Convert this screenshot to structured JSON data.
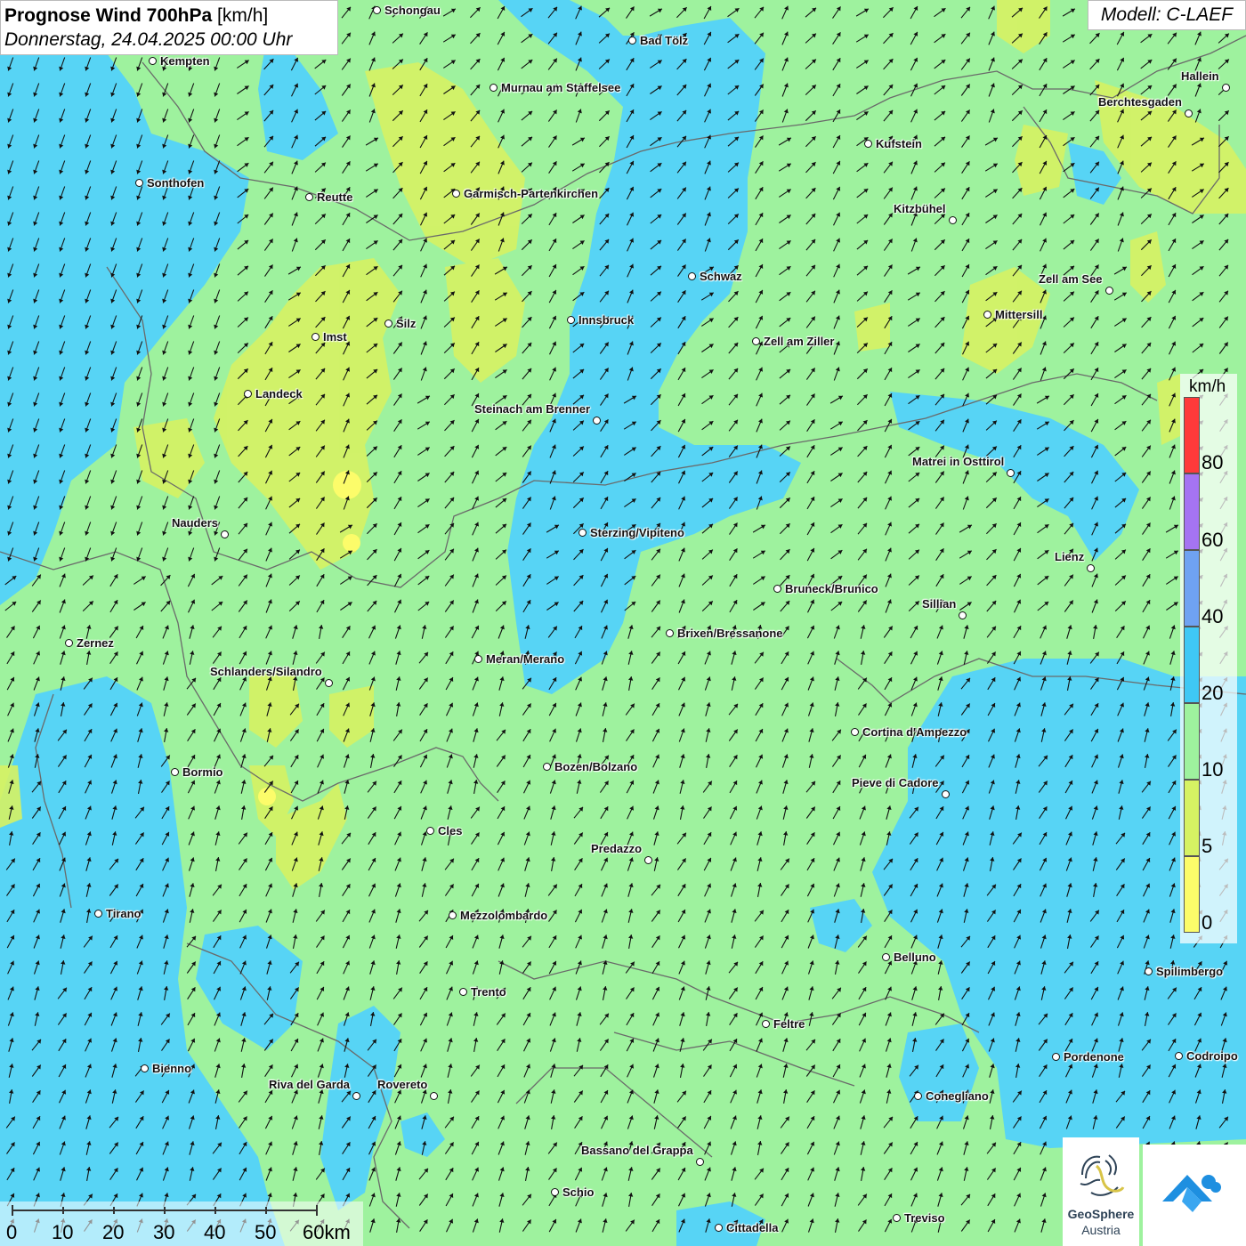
{
  "header": {
    "title_bold": "Prognose Wind 700hPa",
    "title_unit": " [km/h]",
    "date": "Donnerstag, 24.04.2025 00:00 Uhr",
    "model": "Modell: C-LAEF"
  },
  "legend": {
    "unit": "km/h",
    "ticks": [
      "80",
      "60",
      "40",
      "20",
      "10",
      "5",
      "0"
    ],
    "colors": [
      "#ff3a3a",
      "#a574f2",
      "#6fa2f2",
      "#3fc8f5",
      "#9ef29e",
      "#d6f263",
      "#fcfc6a"
    ]
  },
  "scalebar": {
    "labels": [
      "0",
      "10",
      "20",
      "30",
      "40",
      "50",
      "60km"
    ]
  },
  "logo": {
    "name_line1": "GeoSphere",
    "name_line2": "Austria",
    "icon": "geosphere-logo-icon",
    "second_icon": "cloud-arrow-icon"
  },
  "colors": {
    "zone_0_5": "#fcfc6a",
    "zone_5_10": "#d6f263",
    "zone_10_20": "#9ef29e",
    "zone_20_40": "#57d4f5",
    "border": "#6a6a6a"
  },
  "cities": [
    {
      "name": "Schongau"
    },
    {
      "name": "Bad Tölz"
    },
    {
      "name": "Kempten"
    },
    {
      "name": "Murnau am Staffelsee"
    },
    {
      "name": "Hallein"
    },
    {
      "name": "Berchtesgaden"
    },
    {
      "name": "Kufstein"
    },
    {
      "name": "Sonthofen"
    },
    {
      "name": "Reutte"
    },
    {
      "name": "Garmisch-Partenkirchen"
    },
    {
      "name": "Kitzbühel"
    },
    {
      "name": "Schwaz"
    },
    {
      "name": "Zell am See"
    },
    {
      "name": "Mittersill"
    },
    {
      "name": "Innsbruck"
    },
    {
      "name": "Silz"
    },
    {
      "name": "Imst"
    },
    {
      "name": "Zell am Ziller"
    },
    {
      "name": "Landeck"
    },
    {
      "name": "Steinach am Brenner"
    },
    {
      "name": "Matrei in Osttirol"
    },
    {
      "name": "Nauders"
    },
    {
      "name": "Sterzing/Vipiteno"
    },
    {
      "name": "Lienz"
    },
    {
      "name": "Bruneck/Brunico"
    },
    {
      "name": "Sillian"
    },
    {
      "name": "Zernez"
    },
    {
      "name": "Brixen/Bressanone"
    },
    {
      "name": "Meran/Merano"
    },
    {
      "name": "Schlanders/Silandro"
    },
    {
      "name": "Cortina d'Ampezzo"
    },
    {
      "name": "Bozen/Bolzano"
    },
    {
      "name": "Bormio"
    },
    {
      "name": "Pieve di Cadore"
    },
    {
      "name": "Cles"
    },
    {
      "name": "Predazzo"
    },
    {
      "name": "Tirano"
    },
    {
      "name": "Mezzolombardo"
    },
    {
      "name": "Belluno"
    },
    {
      "name": "Spilimbergo"
    },
    {
      "name": "Trento"
    },
    {
      "name": "Feltre"
    },
    {
      "name": "Bienno"
    },
    {
      "name": "Pordenone"
    },
    {
      "name": "Codroipo"
    },
    {
      "name": "Riva del Garda"
    },
    {
      "name": "Rovereto"
    },
    {
      "name": "Conegliano"
    },
    {
      "name": "Bassano del Grappa"
    },
    {
      "name": "Schio"
    },
    {
      "name": "Treviso"
    },
    {
      "name": "Cittadella"
    }
  ]
}
